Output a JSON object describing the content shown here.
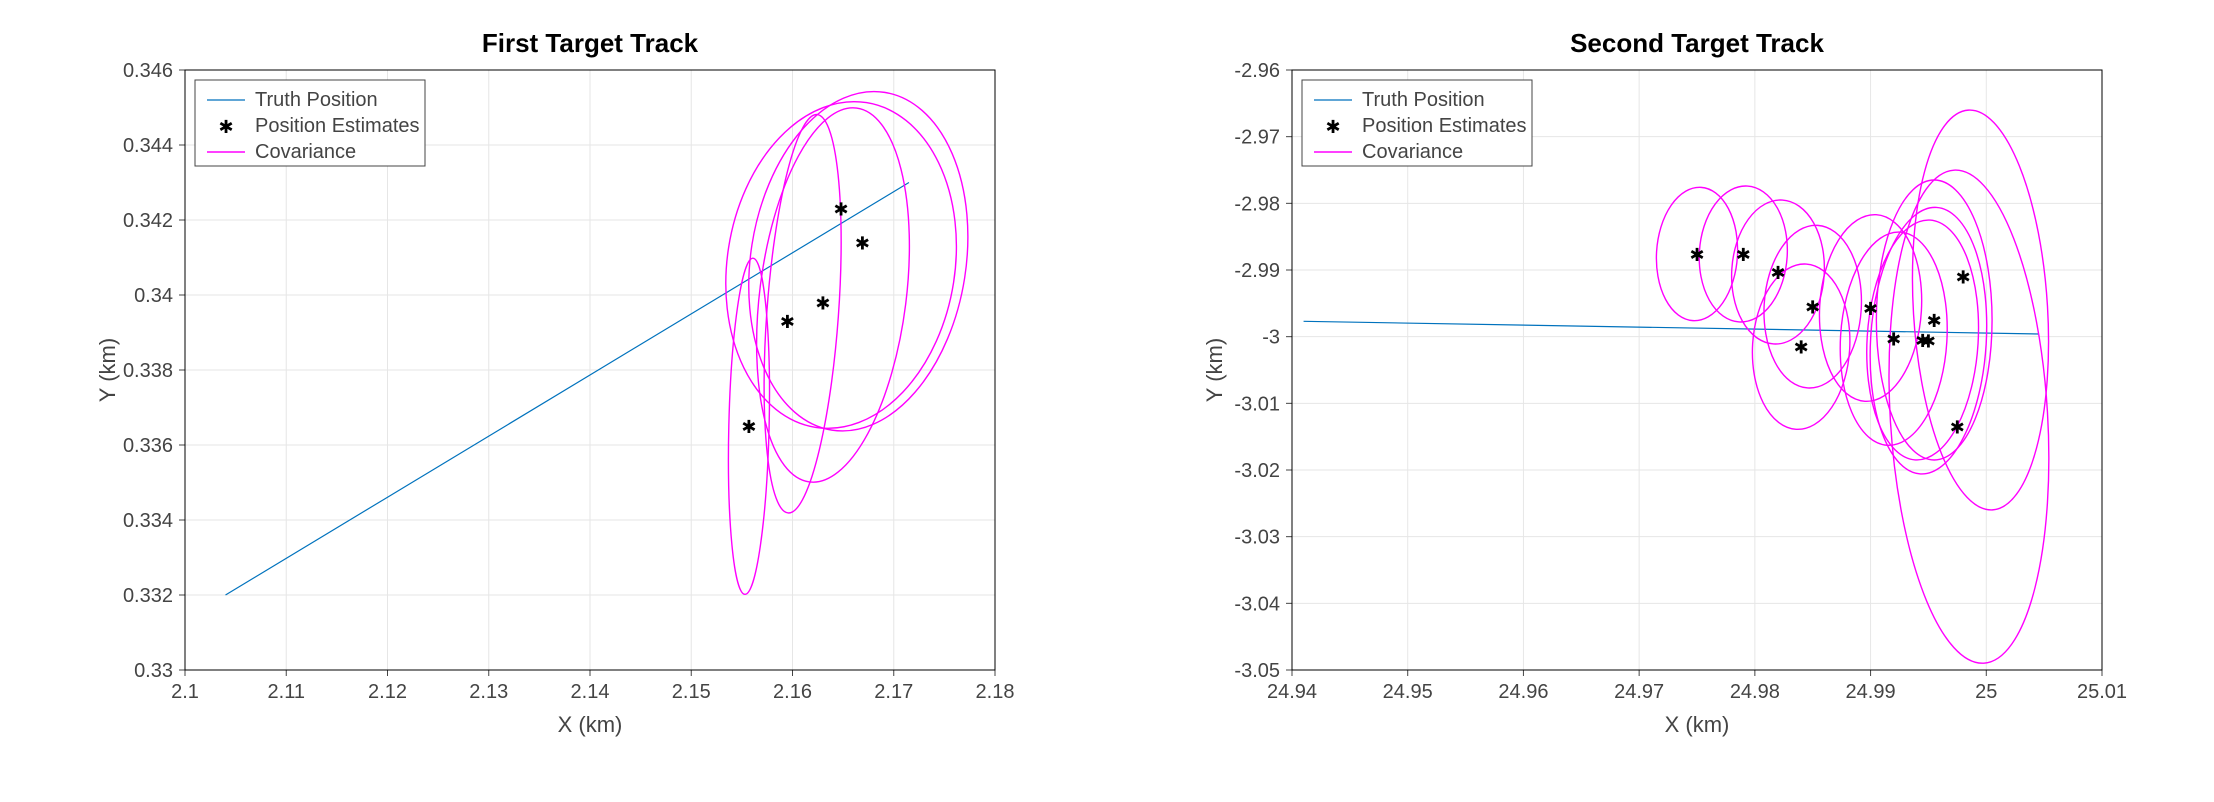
{
  "chart_data": [
    {
      "type": "line",
      "title": "First Target Track",
      "xlabel": "X (km)",
      "ylabel": "Y (km)",
      "xlim": [
        2.1,
        2.18
      ],
      "ylim": [
        0.33,
        0.346
      ],
      "xticks": [
        2.1,
        2.11,
        2.12,
        2.13,
        2.14,
        2.15,
        2.16,
        2.17,
        2.18
      ],
      "yticks": [
        0.33,
        0.332,
        0.334,
        0.336,
        0.338,
        0.34,
        0.342,
        0.344,
        0.346
      ],
      "legend": [
        "Truth Position",
        "Position Estimates",
        "Covariance"
      ],
      "truth_line": [
        [
          2.104,
          0.332
        ],
        [
          2.1715,
          0.343
        ]
      ],
      "estimates": [
        {
          "x": 2.1557,
          "y": 0.3365
        },
        {
          "x": 2.1595,
          "y": 0.3393
        },
        {
          "x": 2.163,
          "y": 0.3398
        },
        {
          "x": 2.1669,
          "y": 0.3414
        },
        {
          "x": 2.1648,
          "y": 0.3423
        }
      ],
      "covariance_ellipses": [
        {
          "cx": 2.1557,
          "cy": 0.3365,
          "rx": 0.0045,
          "ry": 0.0019,
          "rot": 85
        },
        {
          "cx": 2.161,
          "cy": 0.3395,
          "rx": 0.0055,
          "ry": 0.0026,
          "rot": 75
        },
        {
          "cx": 2.164,
          "cy": 0.34,
          "rx": 0.0055,
          "ry": 0.004,
          "rot": 65
        },
        {
          "cx": 2.1665,
          "cy": 0.3409,
          "rx": 0.0052,
          "ry": 0.0052,
          "rot": 60
        },
        {
          "cx": 2.1648,
          "cy": 0.3408,
          "rx": 0.005,
          "ry": 0.0055,
          "rot": 60
        }
      ]
    },
    {
      "type": "line",
      "title": "Second Target Track",
      "xlabel": "X (km)",
      "ylabel": "Y (km)",
      "xlim": [
        24.94,
        25.01
      ],
      "ylim": [
        -3.05,
        -2.96
      ],
      "xticks": [
        24.94,
        24.95,
        24.96,
        24.97,
        24.98,
        24.99,
        25,
        25.01
      ],
      "yticks": [
        -3.05,
        -3.04,
        -3.03,
        -3.02,
        -3.01,
        -3.0,
        -2.99,
        -2.98,
        -2.97,
        -2.96
      ],
      "legend": [
        "Truth Position",
        "Position Estimates",
        "Covariance"
      ],
      "truth_line": [
        [
          24.941,
          -2.9977
        ],
        [
          25.0045,
          -2.9996
        ]
      ],
      "estimates": [
        {
          "x": 24.975,
          "y": -2.9876
        },
        {
          "x": 24.979,
          "y": -2.9876
        },
        {
          "x": 24.982,
          "y": -2.9903
        },
        {
          "x": 24.985,
          "y": -2.9955
        },
        {
          "x": 24.984,
          "y": -3.0015
        },
        {
          "x": 24.99,
          "y": -2.9957
        },
        {
          "x": 24.992,
          "y": -3.0003
        },
        {
          "x": 24.9945,
          "y": -3.0005
        },
        {
          "x": 24.995,
          "y": -3.0006
        },
        {
          "x": 24.9955,
          "y": -2.9975
        },
        {
          "x": 24.998,
          "y": -2.991
        },
        {
          "x": 24.9975,
          "y": -3.0135
        }
      ],
      "covariance_ellipses": [
        {
          "cx": 24.975,
          "cy": -2.9876,
          "rx": 0.01,
          "ry": 0.0035,
          "rot": 88
        },
        {
          "cx": 24.979,
          "cy": -2.9876,
          "rx": 0.0102,
          "ry": 0.0038,
          "rot": 88
        },
        {
          "cx": 24.982,
          "cy": -2.9903,
          "rx": 0.0108,
          "ry": 0.004,
          "rot": 88
        },
        {
          "cx": 24.985,
          "cy": -2.9955,
          "rx": 0.0122,
          "ry": 0.0042,
          "rot": 88
        },
        {
          "cx": 24.984,
          "cy": -3.0015,
          "rx": 0.0124,
          "ry": 0.0042,
          "rot": 88
        },
        {
          "cx": 24.99,
          "cy": -2.9957,
          "rx": 0.014,
          "ry": 0.0044,
          "rot": 88
        },
        {
          "cx": 24.992,
          "cy": -3.0003,
          "rx": 0.016,
          "ry": 0.0046,
          "rot": 88
        },
        {
          "cx": 24.9945,
          "cy": -3.0005,
          "rx": 0.018,
          "ry": 0.0048,
          "rot": 88
        },
        {
          "cx": 24.995,
          "cy": -3.0006,
          "rx": 0.02,
          "ry": 0.005,
          "rot": 88
        },
        {
          "cx": 24.9955,
          "cy": -2.9975,
          "rx": 0.021,
          "ry": 0.005,
          "rot": 90
        },
        {
          "cx": 24.9995,
          "cy": -2.996,
          "rx": 0.03,
          "ry": 0.0058,
          "rot": 92
        },
        {
          "cx": 24.9985,
          "cy": -3.012,
          "rx": 0.037,
          "ry": 0.0068,
          "rot": 92
        }
      ]
    }
  ]
}
